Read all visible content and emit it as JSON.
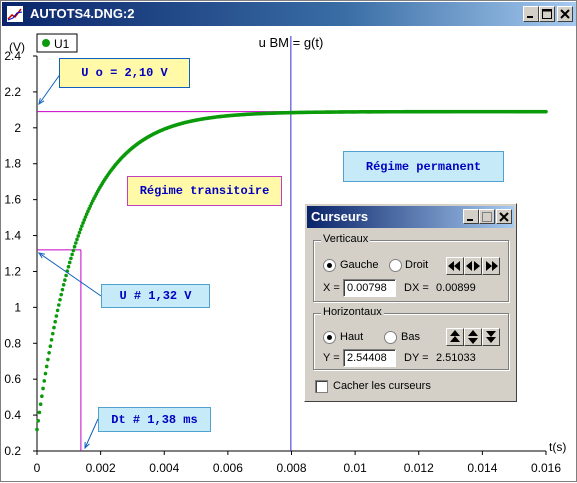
{
  "window": {
    "title": "AUTOTS4.DNG:2"
  },
  "chart_data": {
    "type": "scatter",
    "title": "u BM = g(t)",
    "legend": "U1",
    "xlabel": "t(s)",
    "ylabel": "(V)",
    "xlim": [
      0,
      0.016
    ],
    "ylim": [
      0.2,
      2.4
    ],
    "x_ticks": [
      "0",
      "0.002",
      "0.004",
      "0.006",
      "0.008",
      "0.01",
      "0.012",
      "0.014",
      "0.016"
    ],
    "y_ticks": [
      "0.2",
      "0.4",
      "0.6",
      "0.8",
      "1",
      "1.2",
      "1.4",
      "1.6",
      "1.8",
      "2",
      "2.2",
      "2.4"
    ],
    "series": [
      {
        "name": "U1",
        "model": "exponential rise",
        "y0": 0.32,
        "y_final": 2.09,
        "tau": 0.00138,
        "t_start": 0,
        "t_end": 0.016
      }
    ],
    "cursor_vertical_x": 0.00798,
    "cursor_horizontal_y": 2.09,
    "tau_marker": {
      "x": 0.00138,
      "y": 1.32
    },
    "grid": false
  },
  "annotations": {
    "u0": "U o = 2,10 V",
    "u132": "U # 1,32 V",
    "dt": "Dt # 1,38 ms",
    "transitoire": "Régime transitoire",
    "permanent": "Régime permanent"
  },
  "cursors": {
    "title": "Curseurs",
    "verticaux": {
      "label": "Verticaux",
      "left": "Gauche",
      "right": "Droit",
      "selected": "Gauche",
      "x_label": "X =",
      "x_value": "0.00798",
      "dx_label": "DX =",
      "dx_value": "0.00899"
    },
    "horizontaux": {
      "label": "Horizontaux",
      "top": "Haut",
      "bottom": "Bas",
      "selected": "Haut",
      "y_label": "Y =",
      "y_value": "2.54408",
      "dy_label": "DY =",
      "dy_value": "2.51033"
    },
    "hide_label": "Cacher les curseurs"
  },
  "colors": {
    "curve": "#0a9a0a",
    "cursor_h": "#c800c8",
    "cursor_v": "#3030d0",
    "axis": "#000000"
  }
}
